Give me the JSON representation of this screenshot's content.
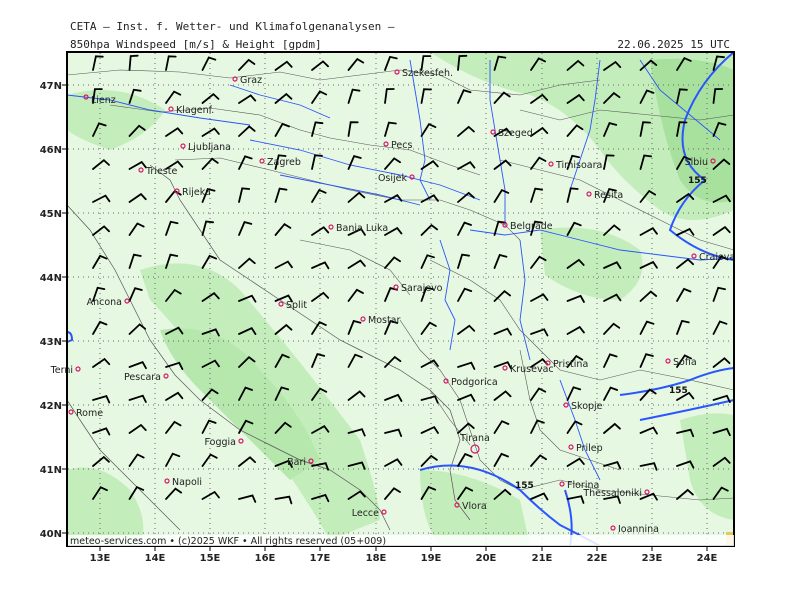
{
  "header": {
    "line1": "CETA — Inst. f. Wetter- und Klimafolgenanalysen —",
    "line2": "850hpa Windspeed [m/s] & Height [gpdm]",
    "datetime": "22.06.2025 15 UTC"
  },
  "map": {
    "lon_labels": [
      "13E",
      "14E",
      "15E",
      "16E",
      "17E",
      "18E",
      "19E",
      "20E",
      "21E",
      "22E",
      "23E",
      "24E"
    ],
    "lat_labels": [
      "47N",
      "46N",
      "45N",
      "44N",
      "43N",
      "42N",
      "41N",
      "40N"
    ],
    "contour_labels": [
      "155",
      "155",
      "155"
    ],
    "cities": [
      {
        "name": "Lienz"
      },
      {
        "name": "Graz"
      },
      {
        "name": "Szekesfeh."
      },
      {
        "name": "Klagenf."
      },
      {
        "name": "Szeged"
      },
      {
        "name": "Ljubljana"
      },
      {
        "name": "Pecs"
      },
      {
        "name": "Zagreb"
      },
      {
        "name": "Trieste"
      },
      {
        "name": "Timisoara"
      },
      {
        "name": "Sibiu"
      },
      {
        "name": "Osijek"
      },
      {
        "name": "Rijeka"
      },
      {
        "name": "Resita"
      },
      {
        "name": "Banja Luka"
      },
      {
        "name": "Belgrade"
      },
      {
        "name": "Craiova"
      },
      {
        "name": "Sarajevo"
      },
      {
        "name": "Ancona"
      },
      {
        "name": "Split"
      },
      {
        "name": "Mostar"
      },
      {
        "name": "Terni"
      },
      {
        "name": "Pristina"
      },
      {
        "name": "Sofia"
      },
      {
        "name": "Pescara"
      },
      {
        "name": "Krusevac"
      },
      {
        "name": "Podgorica"
      },
      {
        "name": "Rome"
      },
      {
        "name": "Skopje"
      },
      {
        "name": "Tirana"
      },
      {
        "name": "Foggia"
      },
      {
        "name": "Prilep"
      },
      {
        "name": "Bari"
      },
      {
        "name": "Napoli"
      },
      {
        "name": "Thessaloniki"
      },
      {
        "name": "Florina"
      },
      {
        "name": "Vlora"
      },
      {
        "name": "Lecce"
      },
      {
        "name": "Ioannina"
      }
    ]
  },
  "footer": {
    "copyright": "meteo-services.com • (c)2025 WKF • All rights reserved (05+009)"
  },
  "colors": {
    "land_fill": "#e6f8e2",
    "wind_band": "#c4edbc",
    "strong_band": "#a8e09e",
    "rivers": "#2a55ff",
    "contour": "#2a55ff",
    "grid": "#666666",
    "barb": "#000000",
    "city_marker": "#d8186a",
    "corner": "#e8c858"
  },
  "icons": {
    "wind_barb": "wind-barb-icon",
    "city_marker": "city-marker-icon"
  }
}
